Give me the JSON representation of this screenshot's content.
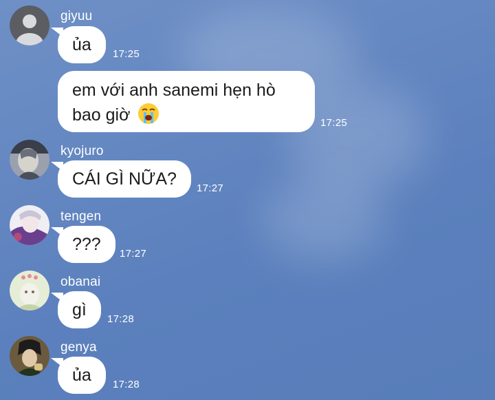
{
  "messages": [
    {
      "sender": "giyuu",
      "avatar_icon": "default-avatar-icon",
      "text": "ủa",
      "time": "17:25"
    },
    {
      "sender": "giyuu",
      "text": "em với anh sanemi hẹn hò bao giờ",
      "emoji": "loudly-crying-face-emoji",
      "time": "17:25"
    },
    {
      "sender": "kyojuro",
      "avatar_icon": "kyojuro-avatar",
      "text": "CÁI GÌ NỮA?",
      "time": "17:27"
    },
    {
      "sender": "tengen",
      "avatar_icon": "tengen-avatar",
      "text": "???",
      "time": "17:27"
    },
    {
      "sender": "obanai",
      "avatar_icon": "obanai-avatar",
      "text": "gì",
      "time": "17:28"
    },
    {
      "sender": "genya",
      "avatar_icon": "genya-avatar",
      "text": "ủa",
      "time": "17:28"
    }
  ],
  "colors": {
    "background": "#6588c2",
    "bubble": "#ffffff",
    "text": "#1b1b1b",
    "meta": "#ffffff"
  }
}
